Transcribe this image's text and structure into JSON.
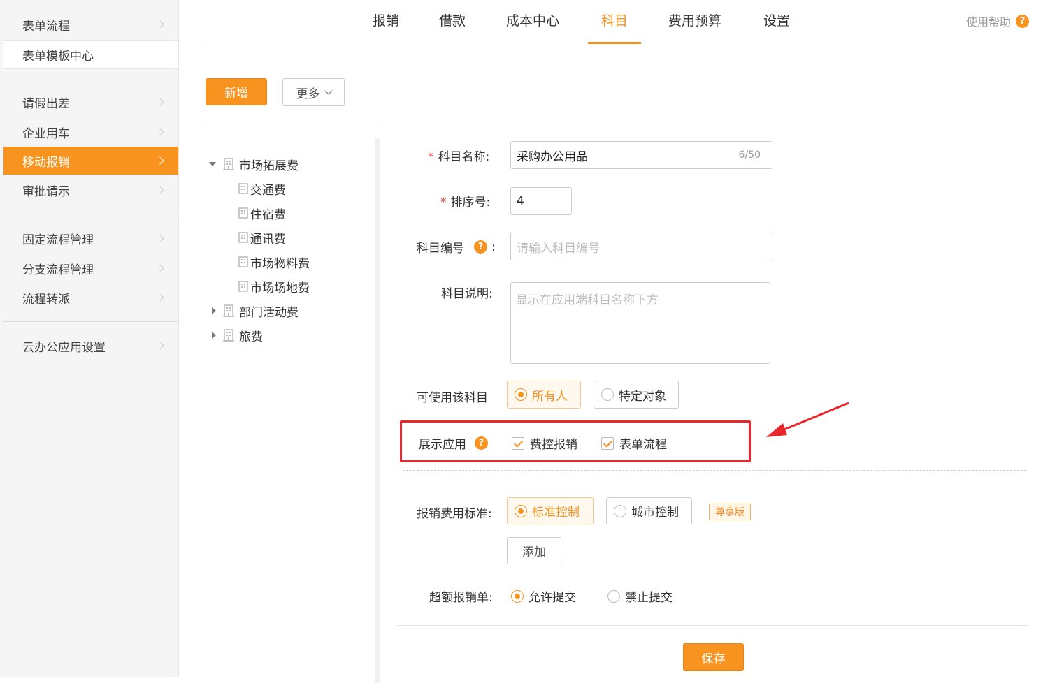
{
  "sidebar": {
    "items": [
      {
        "label": "表单流程"
      },
      {
        "label": "表单模板中心"
      },
      {
        "label": "请假出差"
      },
      {
        "label": "企业用车"
      },
      {
        "label": "移动报销"
      },
      {
        "label": "审批请示"
      },
      {
        "label": "固定流程管理"
      },
      {
        "label": "分支流程管理"
      },
      {
        "label": "流程转派"
      },
      {
        "label": "云办公应用设置"
      }
    ]
  },
  "tabs": [
    {
      "label": "报销"
    },
    {
      "label": "借款"
    },
    {
      "label": "成本中心"
    },
    {
      "label": "科目"
    },
    {
      "label": "费用预算"
    },
    {
      "label": "设置"
    }
  ],
  "help": {
    "label": "使用帮助",
    "icon": "?"
  },
  "toolbar": {
    "add_label": "新增",
    "more_label": "更多"
  },
  "tree": {
    "nodes": [
      {
        "label": "市场拓展费",
        "expanded": true
      },
      {
        "label": "交通费"
      },
      {
        "label": "住宿费"
      },
      {
        "label": "通讯费"
      },
      {
        "label": "市场物料费"
      },
      {
        "label": "市场场地费"
      },
      {
        "label": "部门活动费",
        "expanded": false
      },
      {
        "label": "旅费",
        "expanded": false
      }
    ]
  },
  "form": {
    "name": {
      "required": "*",
      "label": "科目名称:",
      "value": "采购办公用品",
      "counter": "6/50"
    },
    "order": {
      "required": "*",
      "label": "排序号:",
      "value": "4"
    },
    "code": {
      "label": "科目编号",
      "colon": ":",
      "placeholder": "请输入科目编号"
    },
    "desc": {
      "label": "科目说明:",
      "placeholder": "显示在应用端科目名称下方"
    },
    "usable": {
      "label": "可使用该科目",
      "options": [
        "所有人",
        "特定对象"
      ],
      "selected": "所有人"
    },
    "display": {
      "label": "展示应用",
      "options": [
        "费控报销",
        "表单流程"
      ],
      "checked": [
        "费控报销",
        "表单流程"
      ]
    },
    "standard": {
      "label": "报销费用标准:",
      "options": [
        "标准控制",
        "城市控制"
      ],
      "selected": "标准控制",
      "badge": "尊享版",
      "add_label": "添加"
    },
    "over": {
      "label": "超额报销单:",
      "options": [
        "允许提交",
        "禁止提交"
      ],
      "selected": "允许提交"
    },
    "save_label": "保存"
  },
  "colors": {
    "accent": "#f7931e",
    "annotation": "#e8262b"
  }
}
